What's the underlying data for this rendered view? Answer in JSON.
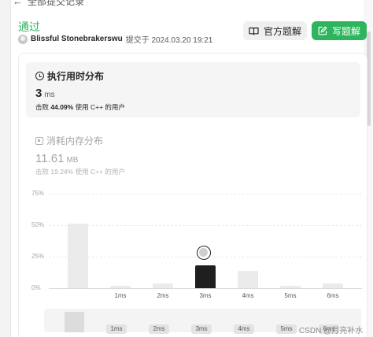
{
  "breadcrumb": {
    "label": "全部提交记录"
  },
  "submission": {
    "status": "通过",
    "username": "Blissful Stonebrakerswu",
    "submitted_text": "提交于 2024.03.20 19:21"
  },
  "actions": {
    "official_solution_label": "官方题解",
    "write_solution_label": "写题解"
  },
  "runtime": {
    "title": "执行用时分布",
    "value": "3",
    "unit": "ms",
    "beats_prefix": "击败",
    "beats_percent": "44.09%",
    "beats_suffix": "使用 C++ 的用户"
  },
  "memory": {
    "title": "消耗内存分布",
    "value": "11.61",
    "unit": "MB",
    "beats_prefix": "击败",
    "beats_percent": "19.24%",
    "beats_suffix": "使用 C++ 的用户"
  },
  "chart_data": {
    "type": "bar",
    "title": "",
    "xlabel": "",
    "ylabel": "",
    "ylim": [
      0,
      75
    ],
    "yticks": [
      "75%",
      "50%",
      "25%",
      "0%"
    ],
    "categories": [
      "",
      "1ms",
      "2ms",
      "3ms",
      "4ms",
      "5ms",
      "6ms"
    ],
    "values": [
      51,
      2,
      3.5,
      18,
      14,
      2,
      4
    ],
    "highlighted_category": "3ms",
    "colors": {
      "bar": "#ebebeb",
      "highlight": "#1f1f1f"
    }
  },
  "navigator": {
    "labels": [
      "1ms",
      "2ms",
      "3ms",
      "4ms",
      "5ms",
      "6ms"
    ]
  },
  "watermark": "CSDN @月亮补水",
  "colors": {
    "accent": "#2db55d",
    "text": "#262626",
    "muted": "#a6a6a6"
  }
}
